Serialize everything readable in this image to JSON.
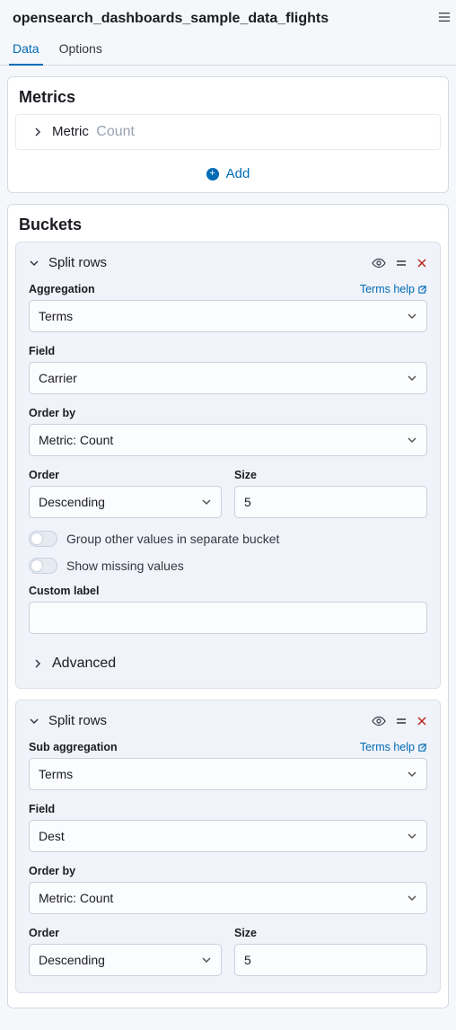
{
  "title": "opensearch_dashboards_sample_data_flights",
  "tabs": {
    "data": "Data",
    "options": "Options"
  },
  "metrics": {
    "heading": "Metrics",
    "item_label": "Metric",
    "item_sub": "Count",
    "add": "Add"
  },
  "buckets": {
    "heading": "Buckets",
    "row1": {
      "title": "Split rows",
      "agg_label": "Aggregation",
      "agg_value": "Terms",
      "help_link": "Terms help",
      "field_label": "Field",
      "field_value": "Carrier",
      "orderby_label": "Order by",
      "orderby_value": "Metric: Count",
      "order_label": "Order",
      "order_value": "Descending",
      "size_label": "Size",
      "size_value": "5",
      "group_other": "Group other values in separate bucket",
      "show_missing": "Show missing values",
      "custom_label": "Custom label",
      "custom_value": "",
      "advanced": "Advanced"
    },
    "row2": {
      "title": "Split rows",
      "agg_label": "Sub aggregation",
      "agg_value": "Terms",
      "help_link": "Terms help",
      "field_label": "Field",
      "field_value": "Dest",
      "orderby_label": "Order by",
      "orderby_value": "Metric: Count",
      "order_label": "Order",
      "order_value": "Descending",
      "size_label": "Size",
      "size_value": "5"
    }
  }
}
